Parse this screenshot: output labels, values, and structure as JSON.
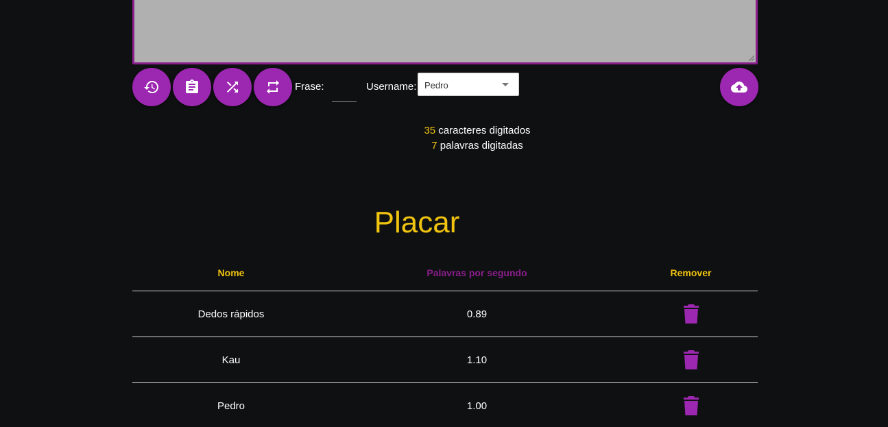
{
  "colors": {
    "background": "#0f1012",
    "accent_purple": "#9c27b0",
    "accent_yellow": "#f0c30f",
    "textarea_bg": "#b0b0b0"
  },
  "toolbar": {
    "buttons": [
      {
        "icon": "history-icon"
      },
      {
        "icon": "clipboard-icon"
      },
      {
        "icon": "shuffle-icon"
      },
      {
        "icon": "repeat-icon"
      }
    ],
    "frase_label": "Frase:",
    "frase_value": "",
    "username_label": "Username:",
    "username_selected": "Pedro",
    "upload_icon": "cloud-upload-icon"
  },
  "stats": {
    "characters_count": "35",
    "characters_label": "caracteres digitados",
    "words_count": "7",
    "words_label": "palavras digitadas"
  },
  "scoreboard": {
    "title": "Placar",
    "headers": {
      "name": "Nome",
      "wps": "Palavras por segundo",
      "remove": "Remover"
    },
    "rows": [
      {
        "name": "Dedos rápidos",
        "wps": "0.89",
        "remove_icon": "trash-icon"
      },
      {
        "name": "Kau",
        "wps": "1.10",
        "remove_icon": "trash-icon"
      },
      {
        "name": "Pedro",
        "wps": "1.00",
        "remove_icon": "trash-icon"
      }
    ]
  }
}
